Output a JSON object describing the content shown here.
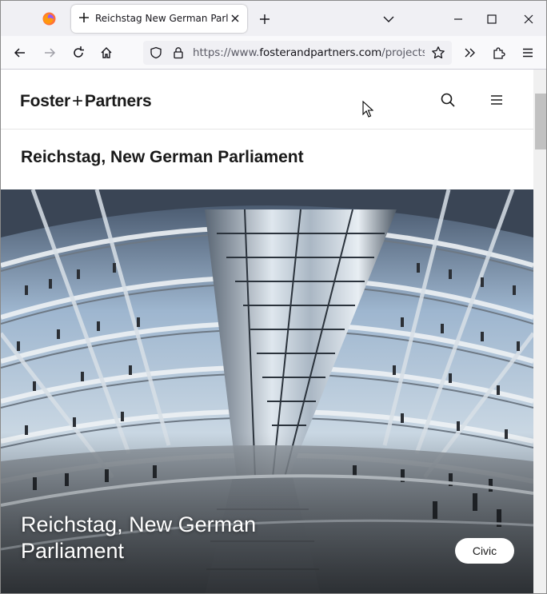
{
  "browser": {
    "tab_title": "Reichstag New German Parliament",
    "url_prefix": "https://www.",
    "url_domain": "fosterandpartners.com",
    "url_path": "/projects/reichstag-new-german-parliament"
  },
  "site": {
    "logo_left": "Foster",
    "logo_plus": "+",
    "logo_right": "Partners"
  },
  "project": {
    "title": "Reichstag, New German Parliament",
    "hero_caption": "Reichstag, New German Parliament",
    "tag": "Civic"
  },
  "colors": {
    "accent_firefox": "#ff7139",
    "page_text": "#1a1a1a",
    "chrome_bg": "#f0f0f4"
  }
}
